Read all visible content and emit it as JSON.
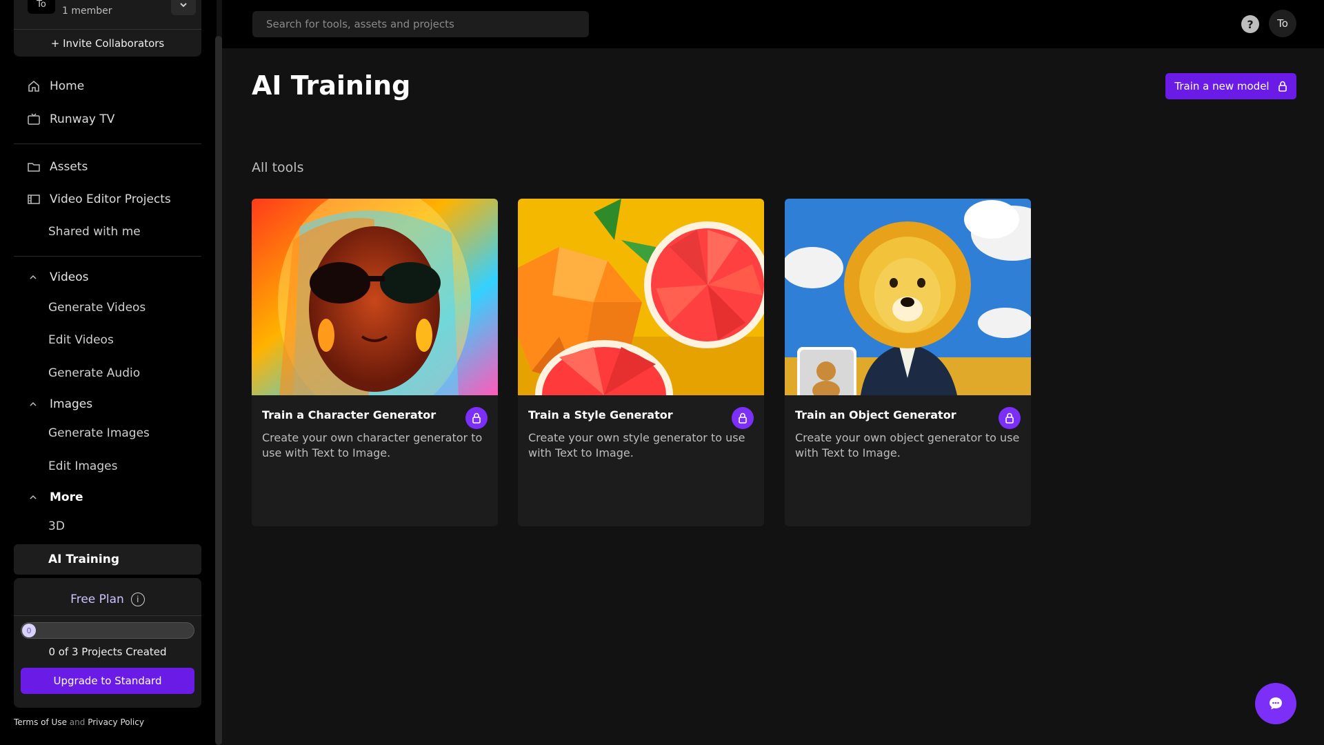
{
  "team": {
    "avatar_text": "To",
    "members": "1 member",
    "invite_label": "+ Invite Collaborators"
  },
  "nav": {
    "home": "Home",
    "runway_tv": "Runway TV",
    "assets": "Assets",
    "video_editor_projects": "Video Editor Projects",
    "shared_with_me": "Shared with me",
    "videos": {
      "label": "Videos",
      "items": [
        "Generate Videos",
        "Edit Videos",
        "Generate Audio"
      ]
    },
    "images": {
      "label": "Images",
      "items": [
        "Generate Images",
        "Edit Images"
      ]
    },
    "more": {
      "label": "More",
      "items": [
        "3D",
        "AI Training"
      ]
    }
  },
  "plan": {
    "title": "Free Plan",
    "info_icon": "i",
    "progress_value": "0",
    "progress_fraction": 0,
    "count_text": "0 of 3 Projects Created",
    "upgrade_label": "Upgrade to Standard"
  },
  "legal": {
    "terms": "Terms of Use",
    "and": "and",
    "privacy": "Privacy Policy"
  },
  "topbar": {
    "search_placeholder": "Search for tools, assets and projects",
    "help_icon": "?",
    "user_initials": "To"
  },
  "main": {
    "title": "AI Training",
    "train_button": "Train a new model",
    "section_label": "All tools",
    "cards": [
      {
        "title": "Train a Character Generator",
        "description": "Create your own character generator to use with Text to Image."
      },
      {
        "title": "Train a Style Generator",
        "description": "Create your own style generator to use with Text to Image."
      },
      {
        "title": "Train an Object Generator",
        "description": "Create your own object generator to use with Text to Image."
      }
    ]
  },
  "colors": {
    "accent": "#6a1ce6",
    "accent_light": "#7b2ff7",
    "background": "#121212",
    "sidebar": "#000000",
    "card": "#1c1c1c"
  },
  "icons": {
    "home": "home-icon",
    "tv": "tv-icon",
    "folder": "folder-icon",
    "video_editor": "film-icon",
    "lock": "lock-icon",
    "chat": "chat-icon"
  }
}
